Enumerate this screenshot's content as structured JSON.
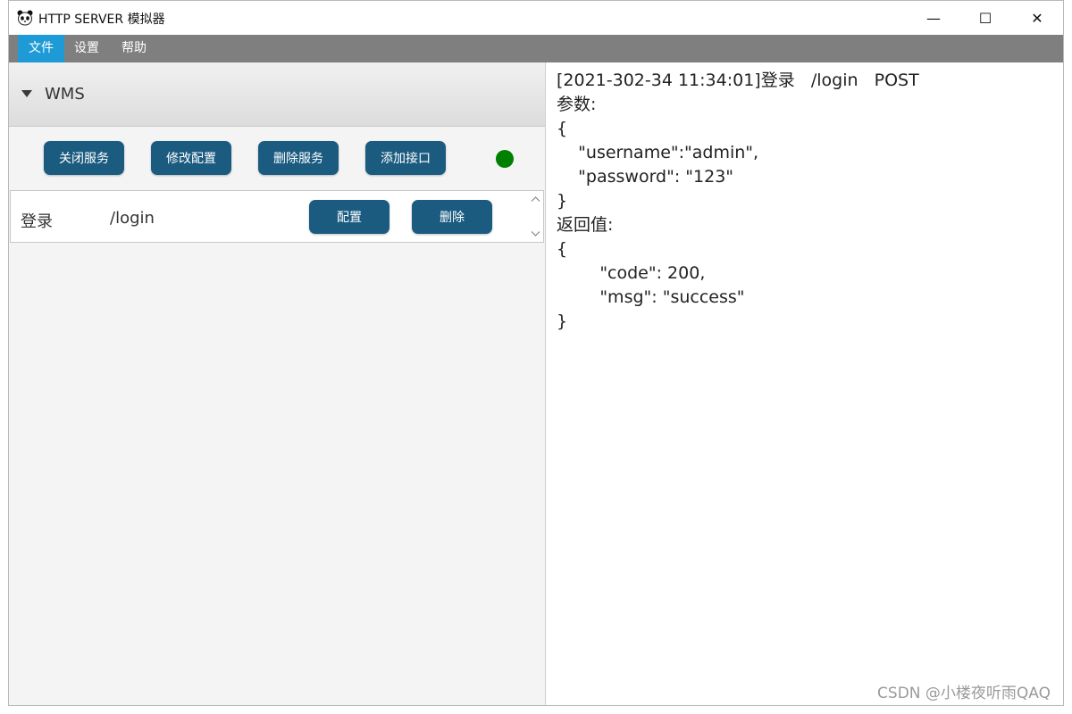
{
  "window": {
    "title": "HTTP SERVER 模拟器",
    "controls": {
      "minimize": "—",
      "maximize": "☐",
      "close": "✕"
    }
  },
  "menu": {
    "items": [
      "文件",
      "设置",
      "帮助"
    ],
    "active_index": 0
  },
  "service": {
    "name": "WMS",
    "buttons": {
      "close_service": "关闭服务",
      "modify_config": "修改配置",
      "delete_service": "删除服务",
      "add_api": "添加接口"
    },
    "status_color": "#008000"
  },
  "apis": [
    {
      "name": "登录",
      "path": "/login",
      "config_label": "配置",
      "delete_label": "删除"
    }
  ],
  "log": {
    "lines": [
      "[2021-302-34 11:34:01]登录   /login   POST",
      "参数:",
      "{",
      "    \"username\":\"admin\",",
      "    \"password\": \"123\"",
      "}",
      "返回值:",
      "{",
      "        \"code\": 200,",
      "        \"msg\": \"success\"",
      "}"
    ]
  },
  "watermark": "CSDN @小楼夜听雨QAQ",
  "colors": {
    "menubar": "#7f7f7f",
    "menu_active": "#1e9bd6",
    "button": "#1b5b80"
  }
}
